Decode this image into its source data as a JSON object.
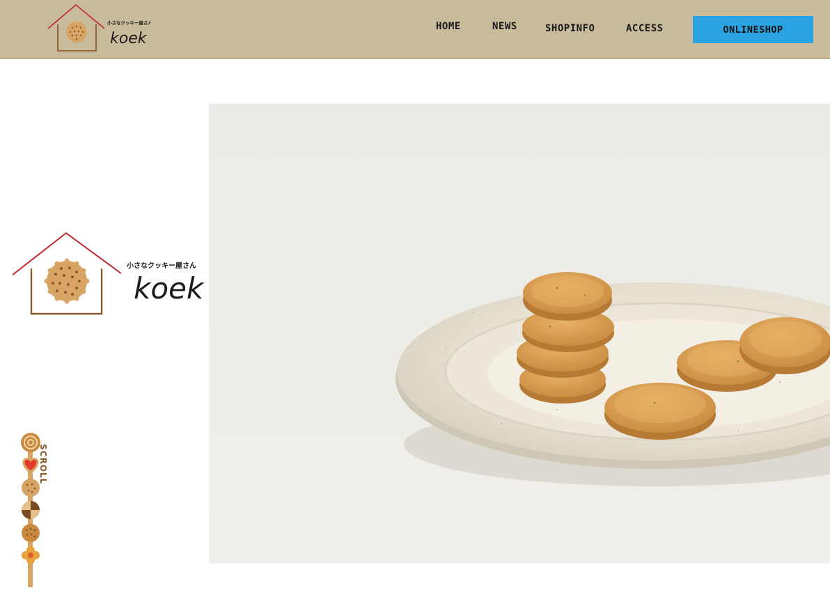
{
  "brand": {
    "tagline": "小さなクッキー屋さん",
    "name": "koek"
  },
  "nav": {
    "items": [
      "HOME",
      "NEWS",
      "SHOPINFO",
      "ACCESS"
    ],
    "online_shop": "ONLINESHOP"
  },
  "hero": {
    "tagline": "小さなクッキー屋さん",
    "name": "koek"
  },
  "scroll": {
    "label": "SCROLL"
  },
  "colors": {
    "header_bg": "#c8bb9c",
    "button_bg": "#2aa3e2",
    "roof_red": "#c0282b",
    "cookie": "#d7a463",
    "house_brown": "#8a5a2b"
  }
}
